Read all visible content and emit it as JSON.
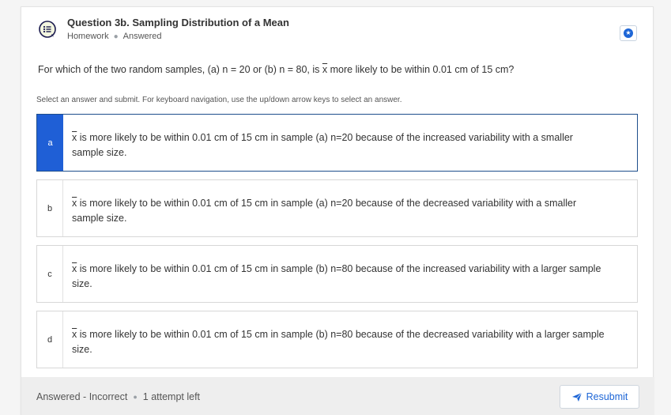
{
  "header": {
    "title": "Question 3b. Sampling Distribution of a Mean",
    "type": "Homework",
    "status": "Answered",
    "icon": "question-list-icon",
    "favorite_icon": "star-icon"
  },
  "question": {
    "prefix": "For which of the two random samples, (a) n = 20 or (b) n = 80, is ",
    "symbol": "x",
    "suffix": " more likely to be within 0.01 cm of 15 cm?"
  },
  "instructions": "Select an answer and submit. For keyboard navigation, use the up/down arrow keys to select an answer.",
  "options": [
    {
      "letter": "a",
      "symbol": "x",
      "text": " is more likely to be within 0.01 cm of 15 cm in sample (a) n=20 because of the increased variability with a smaller sample size.",
      "selected": true
    },
    {
      "letter": "b",
      "symbol": "x",
      "text": " is more likely to be within 0.01 cm of 15 cm in sample (a) n=20 because of the decreased variability with a smaller sample size.",
      "selected": false
    },
    {
      "letter": "c",
      "symbol": "x",
      "text": " is more likely to be within 0.01 cm of 15 cm in sample (b) n=80 because of the increased variability with a larger sample size.",
      "selected": false
    },
    {
      "letter": "d",
      "symbol": "x",
      "text": " is more likely to be within 0.01 cm of 15 cm in sample (b) n=80 because of the decreased variability with a larger sample size.",
      "selected": false
    }
  ],
  "footer": {
    "status": "Answered - Incorrect",
    "attempts": "1 attempt left",
    "resubmit_label": "Resubmit",
    "resubmit_icon": "send-icon"
  },
  "colors": {
    "accent": "#1f5fd6",
    "selected_border": "#1e4e8c",
    "footer_bg": "#eeeeee"
  }
}
